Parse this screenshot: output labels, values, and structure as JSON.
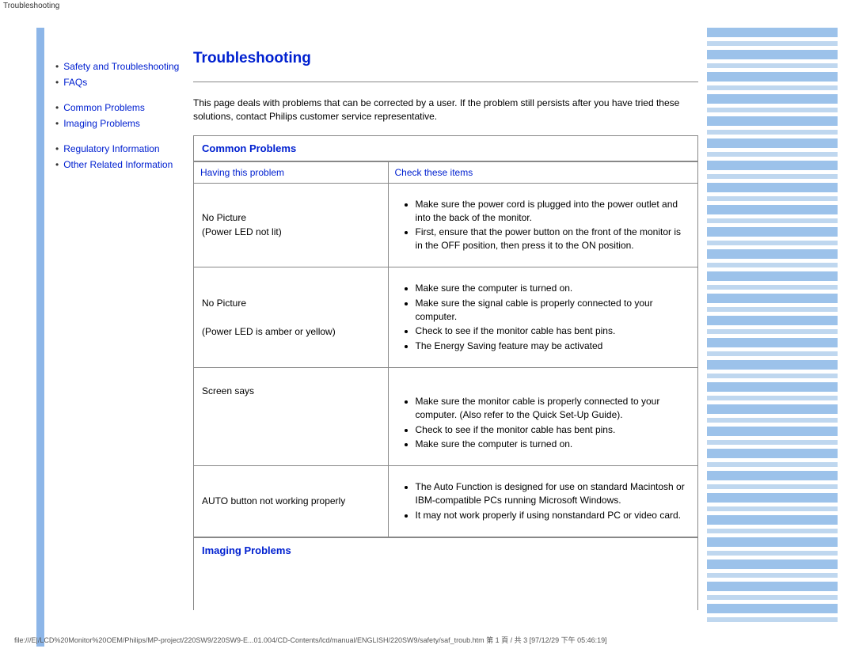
{
  "top_label": "Troubleshooting",
  "sidebar": {
    "groups": [
      {
        "items": [
          {
            "label": "Safety and Troubleshooting"
          },
          {
            "label": "FAQs"
          }
        ]
      },
      {
        "items": [
          {
            "label": "Common Problems"
          },
          {
            "label": "Imaging Problems"
          }
        ]
      },
      {
        "items": [
          {
            "label": "Regulatory Information"
          },
          {
            "label": "Other Related Information"
          }
        ]
      }
    ]
  },
  "main": {
    "title": "Troubleshooting",
    "intro": "This page deals with problems that can be corrected by a user. If the problem still persists after you have tried these solutions, contact Philips customer service representative.",
    "common_problems_title": "Common Problems",
    "col_problem": "Having this problem",
    "col_check": "Check these items",
    "rows": [
      {
        "problem_line1": "No Picture",
        "problem_line2": "(Power LED not lit)",
        "checks": [
          "Make sure the power cord is plugged into the power outlet and into the back of the monitor.",
          "First, ensure that the power button on the front of the monitor is in the OFF position, then press it to the ON position."
        ]
      },
      {
        "problem_line1": "No Picture",
        "problem_line2": "(Power LED is amber or yellow)",
        "checks": [
          "Make sure the computer is turned on.",
          "Make sure the signal cable is properly connected to your computer.",
          "Check to see if the monitor cable has bent pins.",
          "The Energy Saving feature may be activated"
        ]
      },
      {
        "problem_line1": "Screen says",
        "problem_line2": "",
        "checks": [
          "Make sure the monitor cable is properly connected to your computer. (Also refer to the Quick Set-Up Guide).",
          "Check to see if the monitor cable has bent pins.",
          "Make sure the computer is turned on."
        ]
      },
      {
        "problem_line1": "AUTO button not working properly",
        "problem_line2": "",
        "checks": [
          "The Auto Function is designed for use on standard Macintosh or IBM-compatible PCs running Microsoft Windows.",
          "It may not work properly if using nonstandard PC or video card."
        ]
      }
    ],
    "imaging_problems_title": "Imaging Problems"
  },
  "footer_path": "file:///E|/LCD%20Monitor%20OEM/Philips/MP-project/220SW9/220SW9-E...01.004/CD-Contents/lcd/manual/ENGLISH/220SW9/safety/saf_troub.htm 第 1 頁 / 共 3  [97/12/29 下午 05:46:19]"
}
